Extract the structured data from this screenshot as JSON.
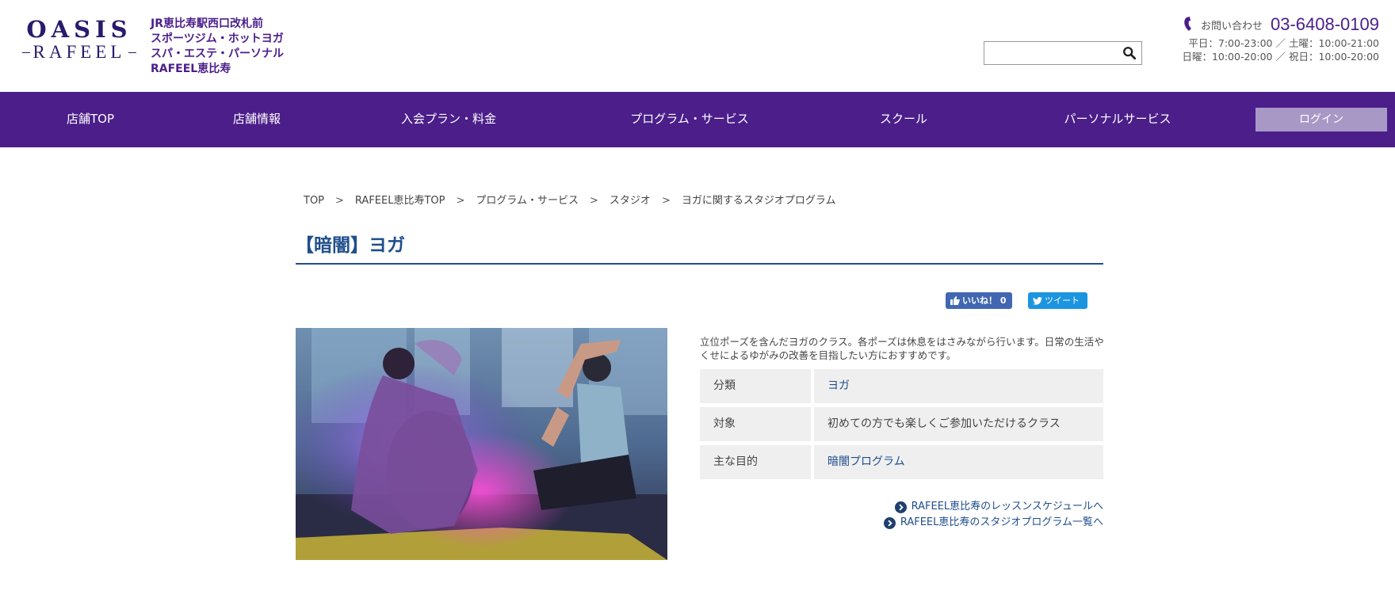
{
  "header": {
    "logo_top": "OASIS",
    "logo_bottom": "RAFEEL",
    "tagline": [
      "JR恵比寿駅西口改札前",
      "スポーツジム・ホットヨガ",
      "スパ・エステ・パーソナル",
      "RAFEEL恵比寿"
    ],
    "search": {
      "value": "",
      "placeholder": ""
    },
    "contact_label": "お問い合わせ",
    "contact_number": "03-6408-0109",
    "hours": [
      "平日：7:00-23:00 ／ 土曜：10:00-21:00",
      "日曜：10:00-20:00 ／ 祝日：10:00-20:00"
    ]
  },
  "nav": {
    "items": [
      "店舗TOP",
      "店舗情報",
      "入会プラン・料金",
      "プログラム・サービス",
      "スクール",
      "パーソナルサービス"
    ],
    "login_label": "ログイン"
  },
  "breadcrumb": [
    "TOP",
    "RAFEEL恵比寿TOP",
    "プログラム・サービス",
    "スタジオ",
    "ヨガに関するスタジオプログラム"
  ],
  "breadcrumb_sep": ">",
  "page_title": "【暗闇】ヨガ",
  "social": {
    "like_label": "いいね！ 0",
    "tweet_label": "ツイート"
  },
  "description": "立位ポーズを含んだヨガのクラス。各ポーズは休息をはさみながら行います。日常の生活やくせによるゆがみの改善を目指したい方におすすめです。",
  "info_table": [
    {
      "label": "分類",
      "value": "ヨガ"
    },
    {
      "label": "対象",
      "value": "初めての方でも楽しくご参加いただけるクラス"
    },
    {
      "label": "主な目的",
      "value": "暗闇プログラム"
    }
  ],
  "links": [
    "RAFEEL恵比寿のレッスンスケジュールへ",
    "RAFEEL恵比寿のスタジオプログラム一覧へ"
  ],
  "colors": {
    "brand_purple": "#4b1e8a",
    "link_blue": "#1f4e8c",
    "login_bg": "#a798c6",
    "facebook": "#4267b2",
    "twitter": "#1b95e0"
  }
}
